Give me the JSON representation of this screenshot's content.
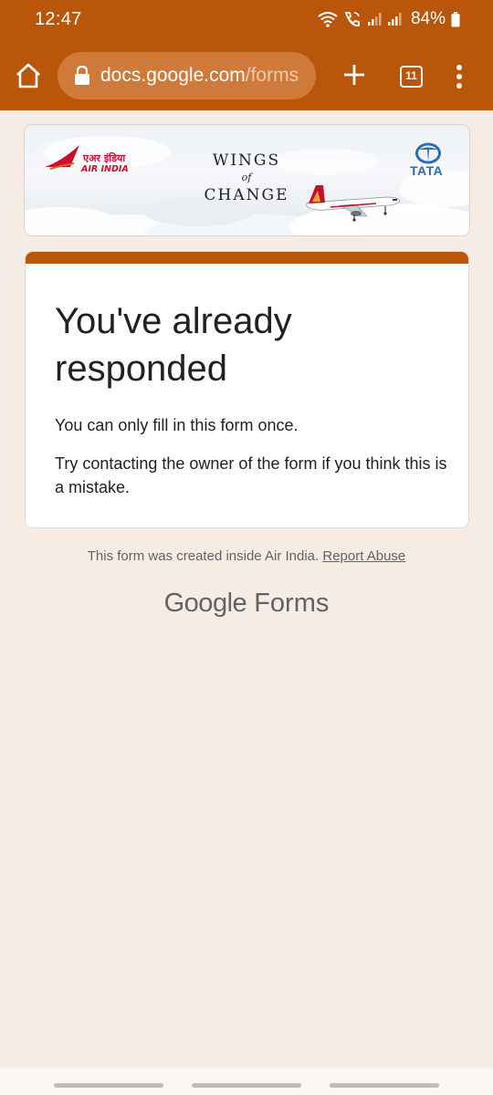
{
  "status_bar": {
    "time": "12:47",
    "battery": "84%"
  },
  "browser": {
    "url_domain": "docs.google.com",
    "url_path": "/forms",
    "tab_count": "11"
  },
  "banner": {
    "airline_hindi": "एअर इंडिया",
    "airline_name": "AIR INDIA",
    "tagline_line1": "WINGS",
    "tagline_of": "of",
    "tagline_line2": "CHANGE",
    "partner": "TATA"
  },
  "card": {
    "title": "You've already responded",
    "message1": "You can only fill in this form once.",
    "message2": "Try contacting the owner of the form if you think this is a mistake."
  },
  "footer": {
    "note": "This form was created inside Air India.",
    "report_link": "Report Abuse",
    "brand_google": "Google",
    "brand_forms": "Forms"
  },
  "colors": {
    "theme": "#b95609",
    "background": "#f7ece4"
  }
}
